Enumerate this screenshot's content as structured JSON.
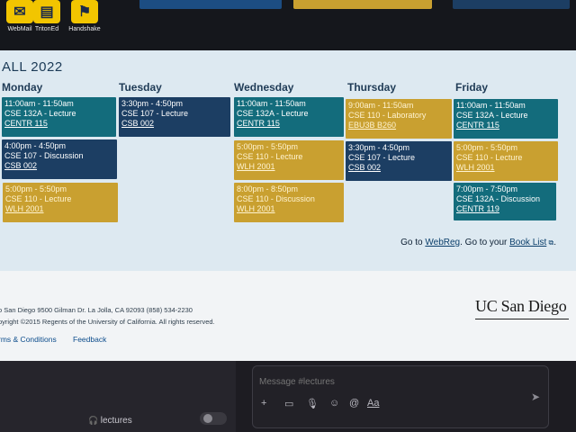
{
  "apps": [
    {
      "label": "WebMail",
      "icon": "mail-icon"
    },
    {
      "label": "TritonEd",
      "icon": "book-icon"
    },
    {
      "label": "Handshake",
      "icon": "handshake-icon"
    }
  ],
  "schedule": {
    "term": "ALL 2022",
    "days": [
      "Monday",
      "Tuesday",
      "Wednesday",
      "Thursday",
      "Friday"
    ],
    "events": [
      {
        "time": "11:00am - 11:50am",
        "course": "CSE 132A - Lecture",
        "location": "CENTR 115",
        "color": "#136c7c"
      },
      {
        "time": "4:00pm - 4:50pm",
        "course": "CSE 107 - Discussion",
        "location": "CSB 002",
        "color": "#1c3e63"
      },
      {
        "time": "5:00pm - 5:50pm",
        "course": "CSE 110 - Lecture",
        "location": "WLH 2001",
        "color": "#c9a030"
      },
      {
        "time": "3:30pm - 4:50pm",
        "course": "CSE 107 - Lecture",
        "location": "CSB 002",
        "color": "#1c3e63"
      },
      {
        "time": "11:00am - 11:50am",
        "course": "CSE 132A - Lecture",
        "location": "CENTR 115",
        "color": "#136c7c"
      },
      {
        "time": "5:00pm - 5:50pm",
        "course": "CSE 110 - Lecture",
        "location": "WLH 2001",
        "color": "#c9a030"
      },
      {
        "time": "8:00pm - 8:50pm",
        "course": "CSE 110 - Discussion",
        "location": "WLH 2001",
        "color": "#c9a030"
      },
      {
        "time": "9:00am - 11:50am",
        "course": "CSE 110 - Laboratory",
        "location": "EBU3B B260",
        "color": "#c9a030"
      },
      {
        "time": "3:30pm - 4:50pm",
        "course": "CSE 107 - Lecture",
        "location": "CSB 002",
        "color": "#1c3e63"
      },
      {
        "time": "11:00am - 11:50am",
        "course": "CSE 132A - Lecture",
        "location": "CENTR 115",
        "color": "#136c7c"
      },
      {
        "time": "5:00pm - 5:50pm",
        "course": "CSE 110 - Lecture",
        "location": "WLH 2001",
        "color": "#c9a030"
      },
      {
        "time": "7:00pm - 7:50pm",
        "course": "CSE 132A - Discussion",
        "location": "CENTR 119",
        "color": "#136c7c"
      }
    ]
  },
  "links": {
    "goto_prefix": "Go to ",
    "webreg": "WebReg",
    "goto_mid": ". Go to your ",
    "booklist": "Book List",
    "suffix": "."
  },
  "footer": {
    "address": "o San Diego 9500 Gilman Dr. La Jolla, CA 92093 (858) 534-2230",
    "copyright": "pyright ©2015 Regents of the University of California. All rights reserved.",
    "terms": "rms & Conditions",
    "feedback": "Feedback",
    "brand": "UC San Diego"
  },
  "chat": {
    "placeholder": "Message #lectures",
    "channel": "lectures",
    "format_label": "Aa"
  }
}
